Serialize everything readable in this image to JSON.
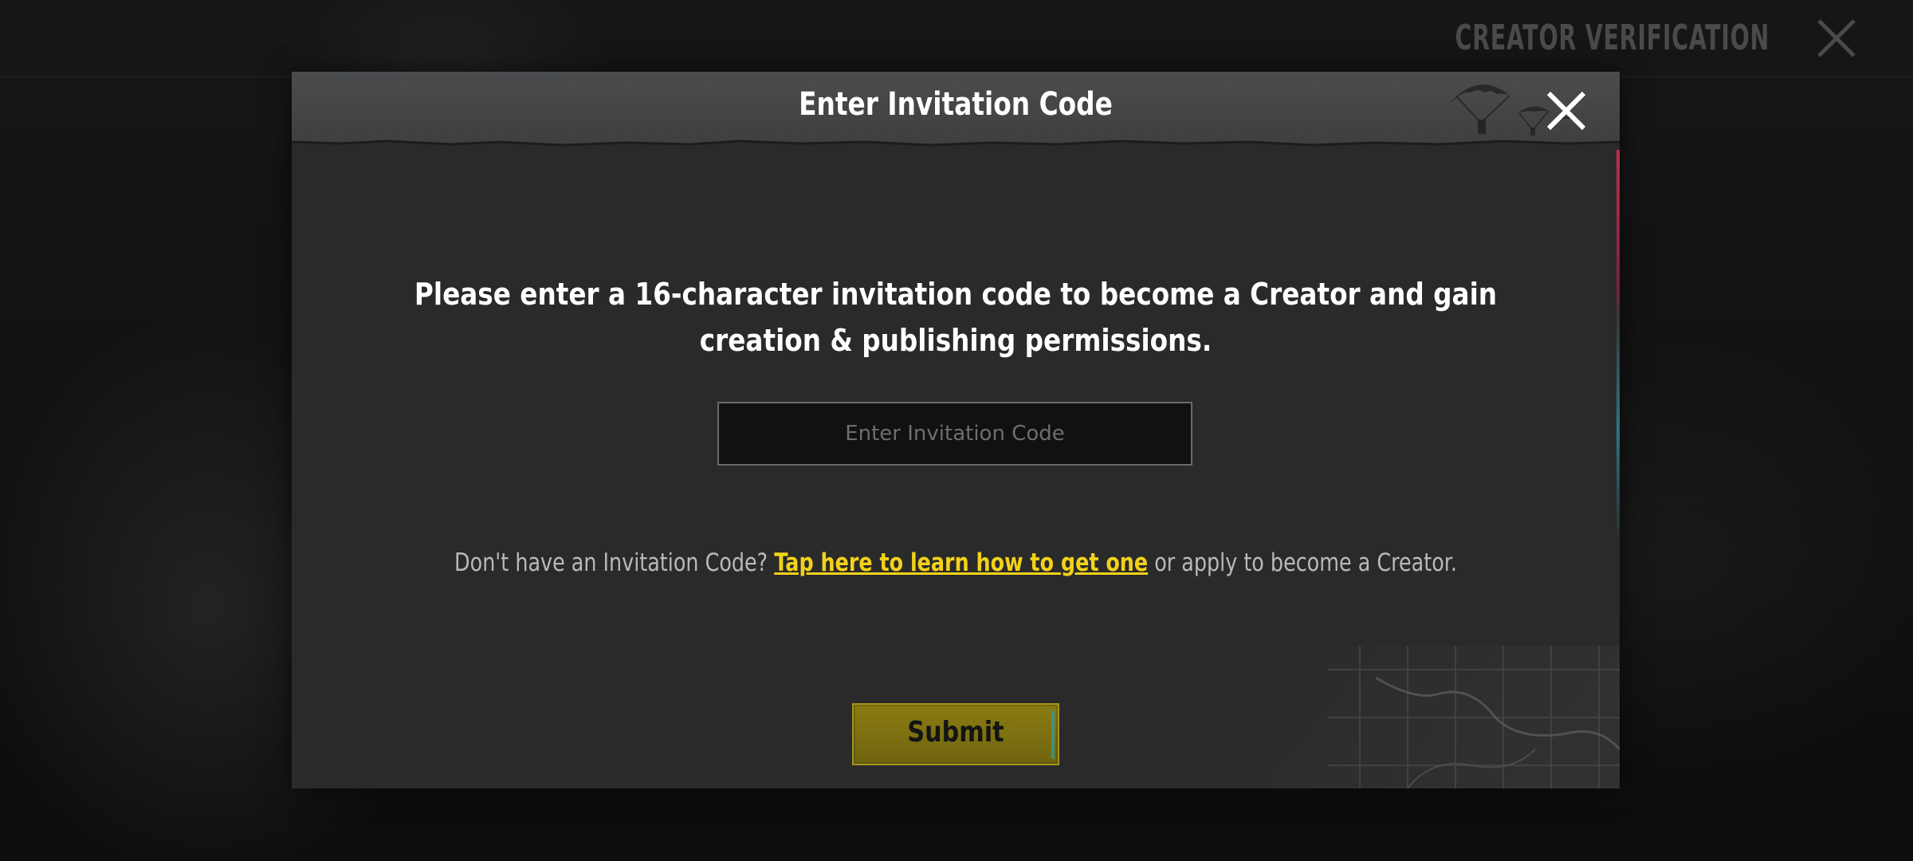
{
  "page": {
    "title": "CREATOR VERIFICATION",
    "close_icon": "close-icon"
  },
  "dialog": {
    "title": "Enter Invitation Code",
    "close_icon": "close-icon",
    "message": "Please enter a 16-character invitation code to become a Creator and gain creation & publishing permissions.",
    "input": {
      "placeholder": "Enter Invitation Code",
      "value": ""
    },
    "help": {
      "prefix": "Don't have an Invitation Code?",
      "link": "Tap here to learn how to get one",
      "suffix": "or apply to become a Creator."
    },
    "submit_label": "Submit",
    "decorations": {
      "header_art": "parachute-icon",
      "corner_art": "map-grid-icon"
    }
  },
  "colors": {
    "link": "#f2d21a",
    "submit": "#8a7c12",
    "dialog_bg": "#2a2a2a",
    "header_bg": "#45474a"
  }
}
